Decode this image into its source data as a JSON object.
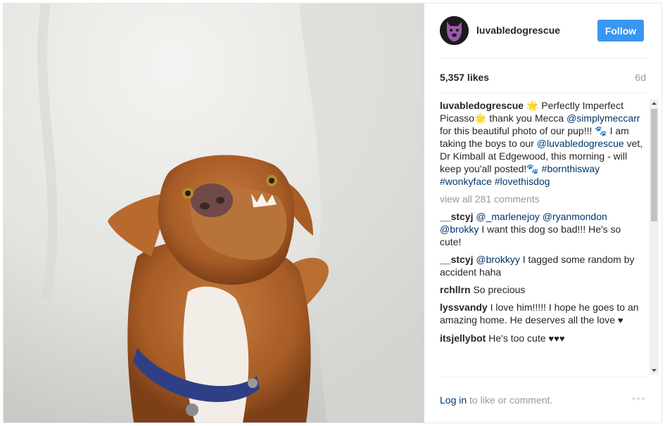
{
  "post": {
    "username": "luvabledogrescue",
    "follow_label": "Follow",
    "likes": "5,357 likes",
    "age": "6d",
    "caption": {
      "username": "luvabledogrescue",
      "part1": " Perfectly Imperfect Picasso",
      "part2": " thank you Mecca ",
      "mention1": "@simplymeccarr",
      "part3": " for this beautiful photo of our pup!!! ",
      "part4": " I am taking the boys to our ",
      "mention2": "@luvabledogrescue",
      "part5": " vet, Dr Kimball at Edgewood, this morning - will keep you'all posted!",
      "tag1": "#bornthisway",
      "tag2": "#wonkyface",
      "tag3": "#lovethisdog"
    },
    "view_all": "view all 281 comments",
    "comments": [
      {
        "username": "__stcyj",
        "mentions": [
          "@_marlenejoy",
          "@ryanmondon",
          "@brokky"
        ],
        "text": " I want this dog so bad!!! He's so cute!"
      },
      {
        "username": "__stcyj",
        "mentions": [
          "@brokkyy"
        ],
        "text": " I tagged some random by accident haha"
      },
      {
        "username": "rchllrn",
        "text": "So precious"
      },
      {
        "username": "lyssvandy",
        "text": "I love him!!!!! I hope he goes to an amazing home. He deserves all the love"
      },
      {
        "username": "itsjellybot",
        "text": "He's too cute"
      }
    ],
    "footer": {
      "login_link": "Log in",
      "login_rest": " to like or comment.",
      "more_icon": "◦◦◦"
    }
  },
  "colors": {
    "accent": "#3897f0",
    "link": "#003569",
    "muted": "#999999"
  },
  "icons": [
    "avatar-dog-logo",
    "sparkle-emoji",
    "paw-emoji",
    "heart-emoji",
    "more-options-icon",
    "scroll-up-arrow",
    "scroll-down-arrow"
  ]
}
